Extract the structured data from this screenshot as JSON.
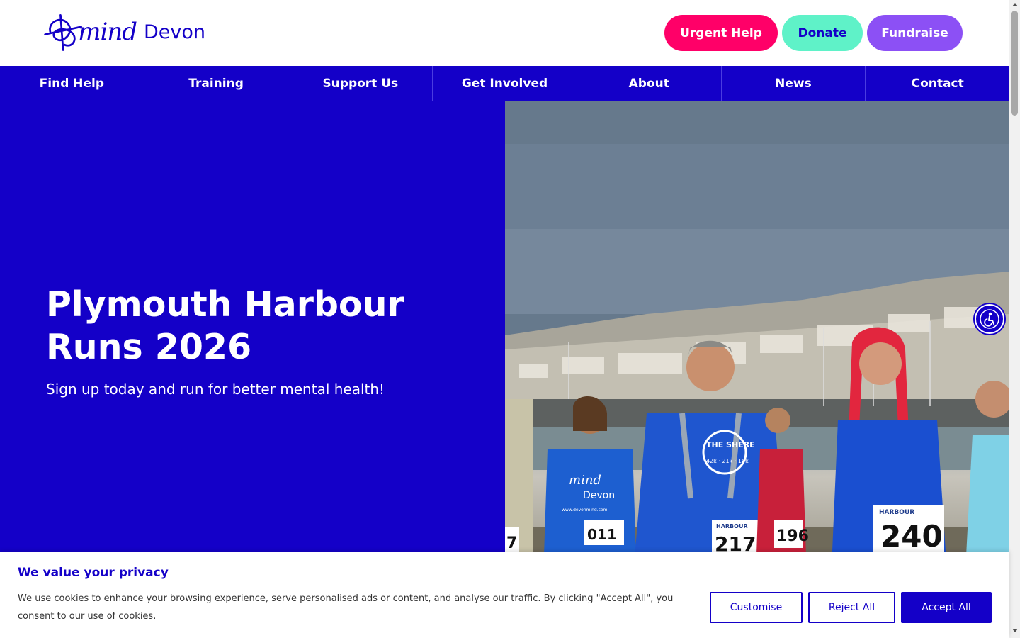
{
  "brand": {
    "logo_mind": "mind",
    "logo_devon": "Devon",
    "primary_color": "#1400c8"
  },
  "header_buttons": {
    "urgent_help": "Urgent Help",
    "donate": "Donate",
    "fundraise": "Fundraise"
  },
  "nav": {
    "items": [
      {
        "label": "Find Help"
      },
      {
        "label": "Training"
      },
      {
        "label": "Support Us"
      },
      {
        "label": "Get Involved"
      },
      {
        "label": "About"
      },
      {
        "label": "News"
      },
      {
        "label": "Contact"
      }
    ]
  },
  "hero": {
    "title": "Plymouth Harbour Runs 2026",
    "subtitle": "Sign up today and run for better mental health!",
    "image_icon": "runners-photo",
    "bib_numbers": [
      "011",
      "217",
      "240",
      "196",
      "7"
    ],
    "shirt_text": "THE SHERE",
    "shirt_sub": "42k · 21k · 10k",
    "shirt_logo_mind": "mind",
    "shirt_logo_devon": "Devon",
    "shirt_url": "www.devonmind.com",
    "bib_header": "HARBOUR"
  },
  "accessibility_widget": {
    "icon": "accessibility-icon"
  },
  "cookie_banner": {
    "title": "We value your privacy",
    "text": "We use cookies to enhance your browsing experience, serve personalised ads or content, and analyse our traffic. By clicking \"Accept All\", you consent to our use of cookies.",
    "customise": "Customise",
    "reject_all": "Reject All",
    "accept_all": "Accept All"
  }
}
